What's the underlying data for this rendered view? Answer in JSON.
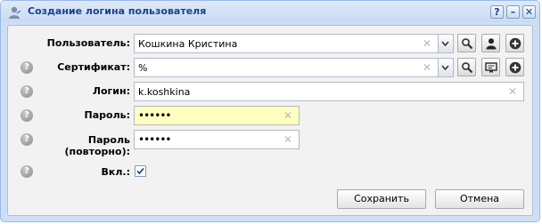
{
  "window": {
    "title": "Создание логина пользователя",
    "tools": {
      "help": "?",
      "minimize": "–",
      "close": "✕"
    }
  },
  "form": {
    "user": {
      "label": "Пользователь:",
      "value": "Кошкина Кристина"
    },
    "certificate": {
      "label": "Сертификат:",
      "value": "%"
    },
    "login": {
      "label": "Логин:",
      "value": "k.koshkina"
    },
    "password": {
      "label": "Пароль:",
      "value": "••••••"
    },
    "password_repeat": {
      "label_line1": "Пароль",
      "label_line2": "(повторно):",
      "value": "••••••"
    },
    "enabled": {
      "label": "Вкл.:",
      "checked": true
    }
  },
  "buttons": {
    "save": "Сохранить",
    "cancel": "Отмена"
  },
  "colors": {
    "title_text": "#15428b",
    "window_frame": "#cedff5",
    "panel": "#f2f2f2",
    "password_highlight": "#ffffc0"
  },
  "icons": [
    "user-icon",
    "help-icon",
    "minimize-icon",
    "close-icon",
    "chevron-down-icon",
    "search-icon",
    "person-icon",
    "add-icon",
    "certificate-icon",
    "clear-icon",
    "checkmark-icon"
  ]
}
